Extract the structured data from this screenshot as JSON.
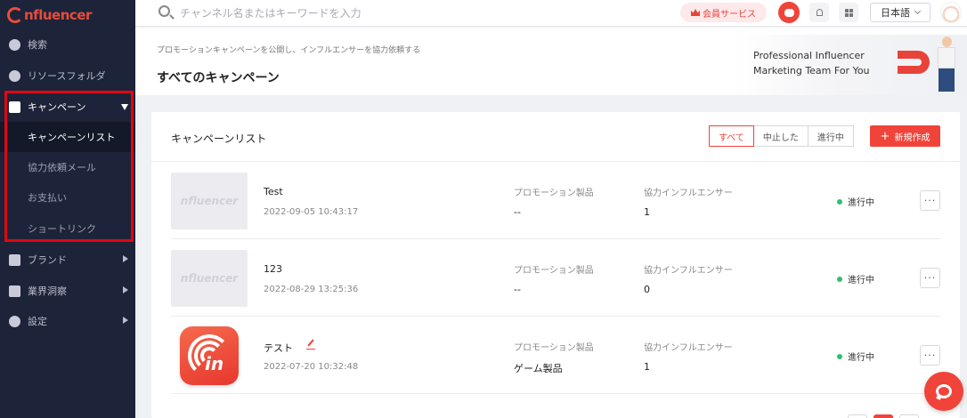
{
  "brand": {
    "logo_text": "nfluencer"
  },
  "sidebar": {
    "items": [
      {
        "label": "検索",
        "icon": "search-circle-icon"
      },
      {
        "label": "リソースフォルダ",
        "icon": "heart-icon"
      },
      {
        "label": "キャンペーン",
        "icon": "document-icon",
        "expanded": true,
        "children": [
          {
            "label": "キャンペーンリスト",
            "active": true
          },
          {
            "label": "協力依頼メール"
          },
          {
            "label": "お支払い"
          },
          {
            "label": "ショートリンク"
          }
        ]
      },
      {
        "label": "ブランド",
        "icon": "brand-r-icon"
      },
      {
        "label": "業界洞察",
        "icon": "chart-icon"
      },
      {
        "label": "設定",
        "icon": "gear-icon"
      }
    ]
  },
  "topbar": {
    "search_placeholder": "チャンネル名またはキーワードを入力",
    "member_label": "会員サービス",
    "language": "日本語"
  },
  "banner": {
    "subtitle": "プロモーションキャンペーンを公開し、インフルエンサーを協力依頼する",
    "title": "すべてのキャンペーン",
    "promo_line1": "Professional Influencer",
    "promo_line2": "Marketing Team For You"
  },
  "list": {
    "title": "キャンペーンリスト",
    "filters": [
      "すべて",
      "中止した",
      "進行中"
    ],
    "active_filter": "すべて",
    "new_button": "新規作成",
    "product_label": "プロモーション製品",
    "influencer_label": "協力インフルエンサー",
    "more_label": "···",
    "rows": [
      {
        "name": "Test",
        "date": "2022-09-05 10:43:17",
        "product": "--",
        "influencers": "1",
        "status": "進行中",
        "thumb": "placeholder"
      },
      {
        "name": "123",
        "date": "2022-08-29 13:25:36",
        "product": "--",
        "influencers": "0",
        "status": "進行中",
        "thumb": "placeholder"
      },
      {
        "name": "テスト",
        "date": "2022-07-20 10:32:48",
        "product": "ゲーム製品",
        "influencers": "1",
        "status": "進行中",
        "thumb": "app-icon"
      }
    ]
  },
  "thumb_placeholder_text": "nfluencer",
  "colors": {
    "accent": "#f0433a",
    "sidebar_bg": "#1d2338",
    "status_green": "#2fbf71",
    "highlight_box": "#e30613"
  }
}
